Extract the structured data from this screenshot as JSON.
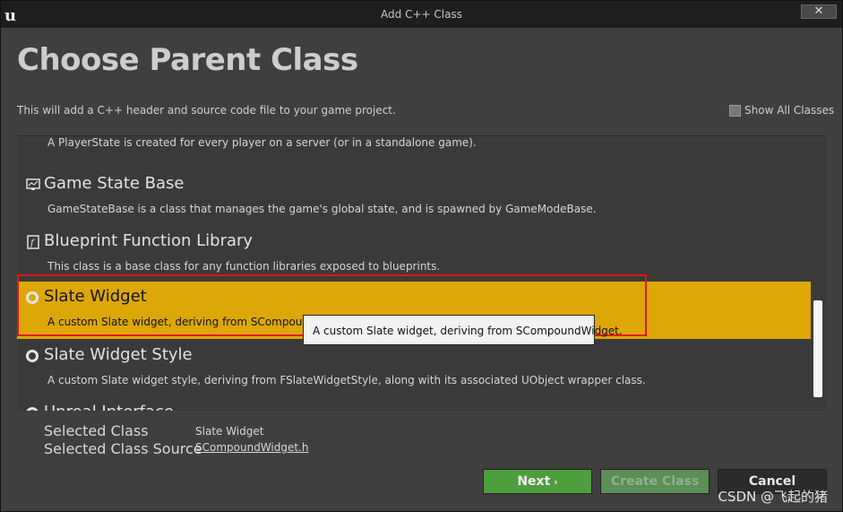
{
  "window": {
    "title": "Add C++ Class",
    "close_icon": "close-icon"
  },
  "header": {
    "heading": "Choose Parent Class",
    "subtitle": "This will add a C++ header and source code file to your game project.",
    "show_all_label": "Show All Classes",
    "show_all_checked": false
  },
  "class_list": {
    "rows": [
      {
        "name": "",
        "desc": "A PlayerState is created for every player on a server (or in a standalone game).",
        "icon": "playerstate-icon"
      },
      {
        "name": "Game State Base",
        "desc": "GameStateBase is a class that manages the game's global state, and is spawned by GameModeBase.",
        "icon": "monitor-icon"
      },
      {
        "name": "Blueprint Function Library",
        "desc": "This class is a base class for any function libraries exposed to blueprints.",
        "icon": "library-icon"
      },
      {
        "name": "Slate Widget",
        "desc": "A custom Slate widget, deriving from SCompoundWidget.",
        "icon": "radio-icon",
        "selected": true
      },
      {
        "name": "Slate Widget Style",
        "desc": "A custom Slate widget style, deriving from FSlateWidgetStyle, along with its associated UObject wrapper class.",
        "icon": "radio-icon"
      },
      {
        "name": "Unreal Interface",
        "desc": "",
        "icon": "radio-icon"
      }
    ],
    "tooltip": "A custom Slate widget, deriving from SCompoundWidget."
  },
  "selection": {
    "class_label": "Selected Class",
    "class_value": "Slate Widget",
    "source_label": "Selected Class Source",
    "source_value": "SCompoundWidget.h"
  },
  "buttons": {
    "next": "Next",
    "create": "Create Class",
    "cancel": "Cancel"
  },
  "watermark": "CSDN @飞起的猪",
  "colors": {
    "selected_row": "#dda707",
    "next_button": "#4e9e3d",
    "highlight_border": "#e01515"
  }
}
